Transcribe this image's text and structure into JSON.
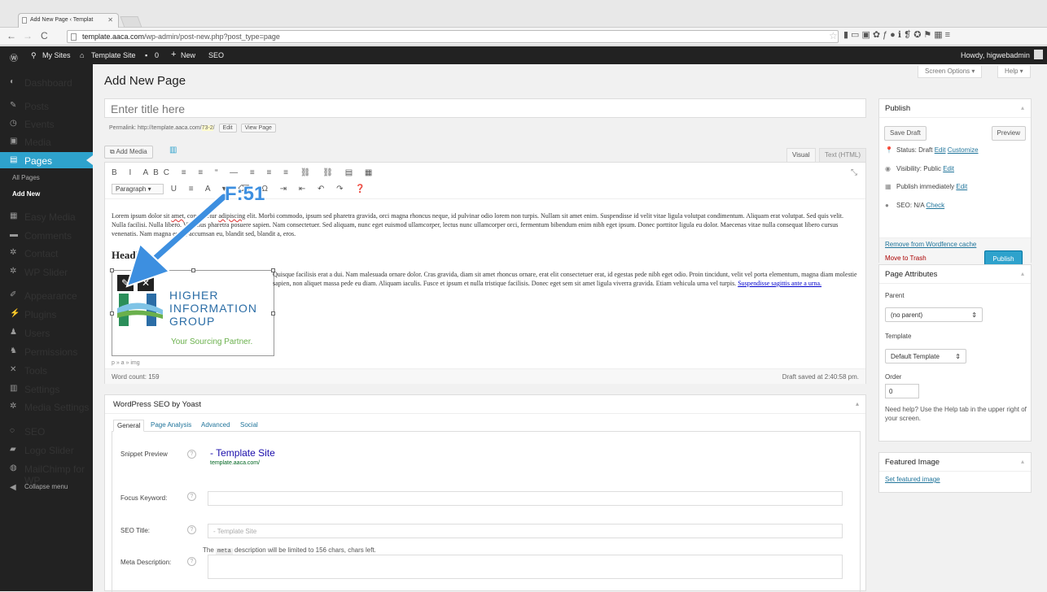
{
  "browser": {
    "tab_title": "Add New Page ‹ Templat",
    "url_host": "template.aaca.com",
    "url_path": "/wp-admin/post-new.php?post_type=page"
  },
  "adminbar": {
    "my_sites": "My Sites",
    "site": "Template Site",
    "comments": "0",
    "new": "New",
    "seo": "SEO",
    "howdy": "Howdy, higwebadmin"
  },
  "sidebar": {
    "items": [
      {
        "label": "Dashboard",
        "icon": "dashboard-icon"
      },
      {
        "label": "Posts",
        "icon": "pin-icon"
      },
      {
        "label": "Events",
        "icon": "calendar-icon"
      },
      {
        "label": "Media",
        "icon": "media-icon"
      },
      {
        "label": "Pages",
        "icon": "page-icon"
      },
      {
        "label": "Easy Media",
        "icon": "easy-media-icon"
      },
      {
        "label": "Comments",
        "icon": "comment-icon"
      },
      {
        "label": "Contact",
        "icon": "gear-icon"
      },
      {
        "label": "WP Slider",
        "icon": "gear-icon"
      },
      {
        "label": "Appearance",
        "icon": "brush-icon"
      },
      {
        "label": "Plugins",
        "icon": "plug-icon"
      },
      {
        "label": "Users",
        "icon": "user-icon"
      },
      {
        "label": "Permissions",
        "icon": "people-icon"
      },
      {
        "label": "Tools",
        "icon": "wrench-icon"
      },
      {
        "label": "Settings",
        "icon": "settings-icon"
      },
      {
        "label": "Media Settings",
        "icon": "gear-icon"
      },
      {
        "label": "SEO",
        "icon": "seo-icon"
      },
      {
        "label": "Logo Slider",
        "icon": "slider-icon"
      },
      {
        "label": "MailChimp for WP",
        "icon": "mailchimp-icon"
      },
      {
        "label": "Collapse menu",
        "icon": "collapse-icon"
      }
    ],
    "sub_all_pages": "All Pages",
    "sub_add_new": "Add New"
  },
  "top": {
    "screen_options": "Screen Options",
    "help": "Help"
  },
  "page_title": "Add New Page",
  "title_placeholder": "Enter title here",
  "permalink": {
    "label": "Permalink:",
    "base": "http://template.aaca.com/",
    "slug": "73-2",
    "edit": "Edit",
    "view": "View Page"
  },
  "editor": {
    "add_media": "Add Media",
    "tab_visual": "Visual",
    "tab_text": "Text (HTML)",
    "toolbar_row1": "B I ABC ≡ ≡ “ — ≡ ≡ ≡ ⛓ ⛓ ▤ ▦",
    "format_select": "Paragraph",
    "toolbar_row2": "U ≡ A ▾ ⌫ Ω ⇥ ⇤ ↶ ↷ ❓",
    "para1_before": "Lorem ipsum dolor sit ",
    "para1_amet": "amet",
    "para1_mid": ", consectetur ",
    "para1_adip": "adipiscing",
    "para1_after": " elit. Morbi commodo, ipsum sed pharetra gravida, orci magna rhoncus neque, id pulvinar odio lorem non turpis. Nullam sit amet enim. Suspendisse id velit vitae ligula volutpat condimentum. Aliquam erat volutpat. Sed quis velit. Nulla facilisi. Nulla libero. Vivamus pharetra posuere sapien. Nam consectetuer. Sed aliquam, nunc eget euismod ullamcorper, lectus nunc ullamcorper orci, fermentum bibendum enim nibh eget ipsum. Donec porttitor ligula eu dolor. Maecenas vitae nulla consequat libero cursus venenatis. Nam magna enim, accumsan eu, blandit sed, blandit a, eros.",
    "heading": "Heading",
    "logo_line1": "HIGHER",
    "logo_line2": "INFORMATION",
    "logo_line3": "GROUP",
    "logo_tagline": "Your Sourcing Partner.",
    "para2": "Quisque facilisis erat a dui. Nam malesuada ornare dolor. Cras gravida, diam sit amet rhoncus ornare, erat elit consectetuer erat, id egestas pede nibh eget odio. Proin tincidunt, velit vel porta elementum, magna diam molestie sapien, non aliquet massa pede eu diam. Aliquam iaculis. Fusce et ipsum et nulla tristique facilisis. Donec eget sem sit amet ligula viverra gravida. Etiam vehicula urna vel turpis. ",
    "para2_link": "Suspendisse sagittis ante a urna.",
    "path": "p » a » img",
    "word_count": "Word count: 159",
    "draft_saved": "Draft saved at 2:40:58 pm."
  },
  "callout": "F:51",
  "yoast": {
    "title": "WordPress SEO by Yoast",
    "tabs": [
      "General",
      "Page Analysis",
      "Advanced",
      "Social"
    ],
    "snippet_label": "Snippet Preview",
    "snippet_title": "- Template Site",
    "snippet_url": "template.aaca.com/",
    "focus_label": "Focus Keyword:",
    "seo_title_label": "SEO Title:",
    "seo_title_placeholder": "- Template Site",
    "meta_label": "Meta Description:",
    "meta_note_pre": "The ",
    "meta_note_code": "meta",
    "meta_note_post": " description will be limited to 156 chars, chars left."
  },
  "publish": {
    "title": "Publish",
    "save_draft": "Save Draft",
    "preview": "Preview",
    "status": "Status: Draft",
    "status_edit": "Edit",
    "status_customize": "Customize",
    "visibility": "Visibility: Public",
    "visibility_edit": "Edit",
    "schedule": "Publish immediately",
    "schedule_edit": "Edit",
    "seo": "SEO: N/A",
    "seo_check": "Check",
    "wordfence": "Remove from Wordfence cache",
    "trash": "Move to Trash",
    "publish": "Publish"
  },
  "page_attributes": {
    "title": "Page Attributes",
    "parent_label": "Parent",
    "parent_value": "(no parent)",
    "template_label": "Template",
    "template_value": "Default Template",
    "order_label": "Order",
    "order_value": "0",
    "help": "Need help? Use the Help tab in the upper right of your screen."
  },
  "featured": {
    "title": "Featured Image",
    "link": "Set featured image"
  },
  "colors": {
    "accent": "#2ea2cc",
    "adminbar": "#222222",
    "callout": "#3d8fe0"
  }
}
